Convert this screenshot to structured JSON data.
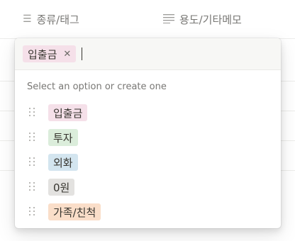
{
  "columns": {
    "tags": {
      "label": "종류/태그",
      "icon": "list-icon"
    },
    "memo": {
      "label": "용도/기타메모",
      "icon": "text-lines-icon"
    }
  },
  "popup": {
    "selected_tag": {
      "label": "입출금",
      "color": "#f5e0e9",
      "remove_symbol": "✕"
    },
    "hint": "Select an option or create one",
    "options": [
      {
        "label": "입출금",
        "color": "#f5e0e9"
      },
      {
        "label": "투자",
        "color": "#dbeddb"
      },
      {
        "label": "외화",
        "color": "#d3e5ef"
      },
      {
        "label": "0원",
        "color": "#e3e2e0"
      },
      {
        "label": "가족/친척",
        "color": "#fadec9"
      }
    ]
  }
}
